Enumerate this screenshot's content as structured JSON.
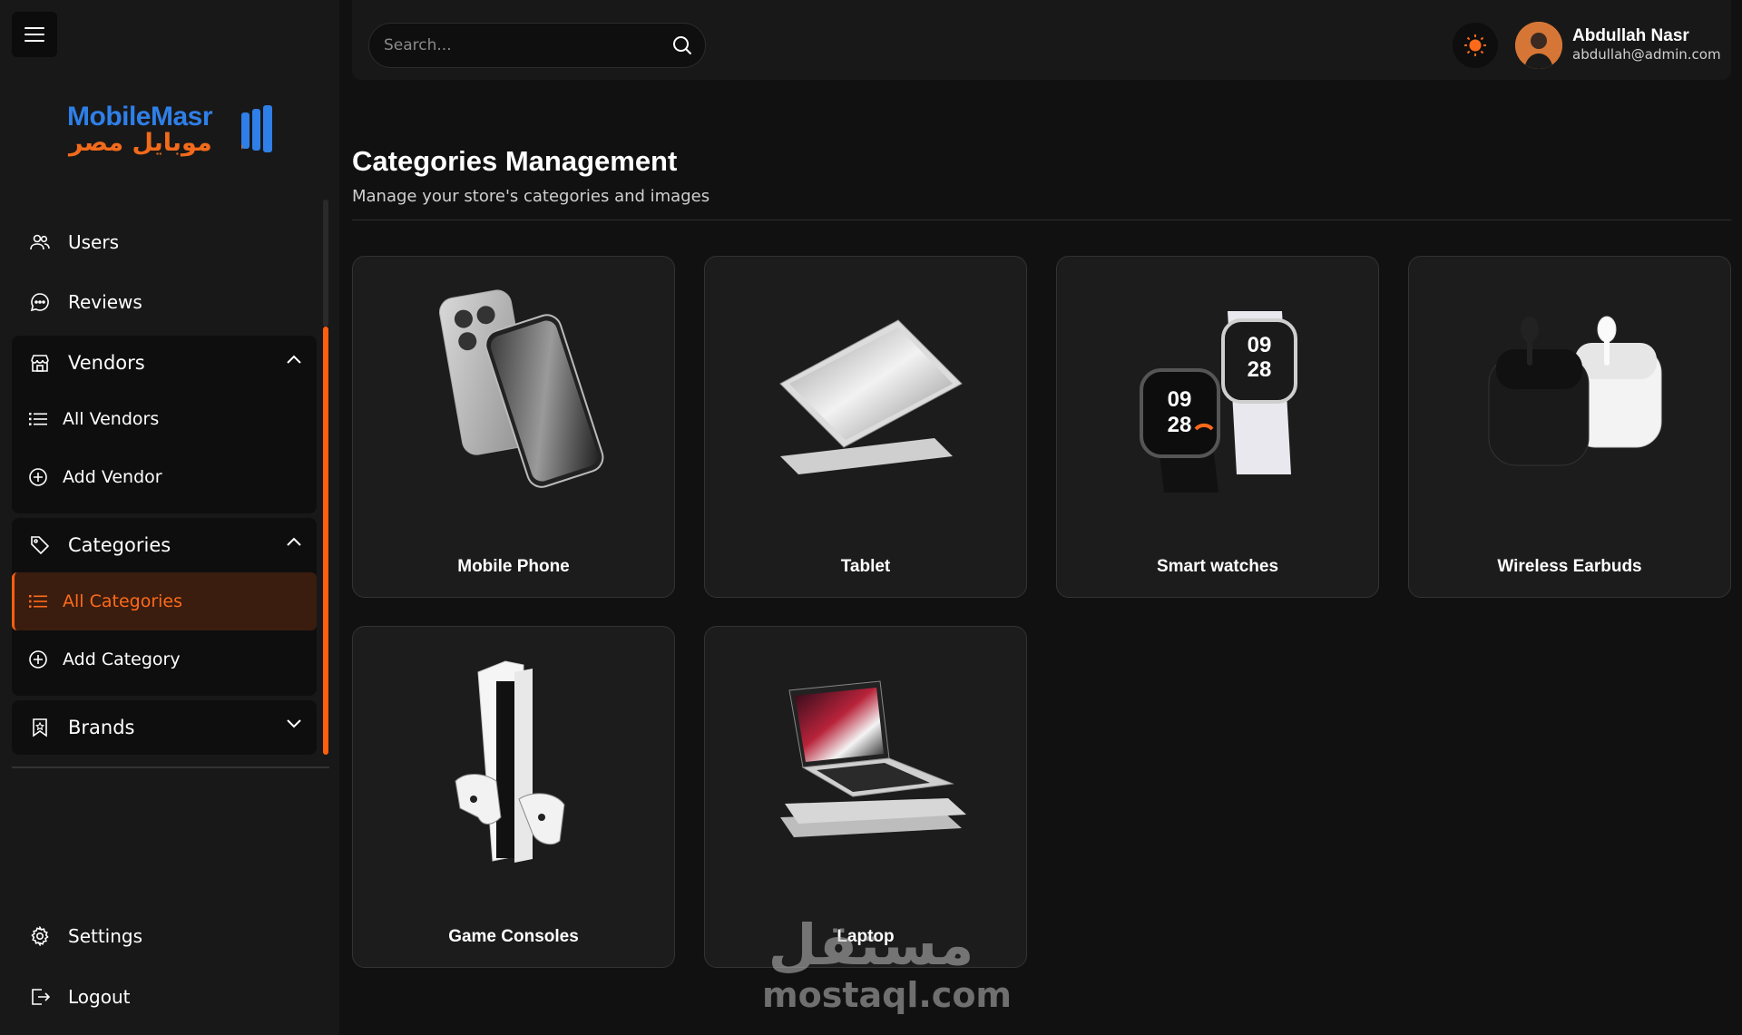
{
  "brand": {
    "name_en": "MobileMasr",
    "name_ar": "موبايل مصر",
    "color_blue": "#2f7fe8",
    "color_orange": "#f26a1b"
  },
  "accent_color": "#ff5e0e",
  "sidebar": {
    "items_top": [
      {
        "label": "Users",
        "icon": "users-icon"
      },
      {
        "label": "Reviews",
        "icon": "chat-icon"
      }
    ],
    "vendors": {
      "label": "Vendors",
      "icon": "store-icon",
      "expanded": true,
      "items": [
        {
          "label": "All Vendors",
          "icon": "list-icon"
        },
        {
          "label": "Add Vendor",
          "icon": "plus-circle-icon"
        }
      ]
    },
    "categories": {
      "label": "Categories",
      "icon": "tag-icon",
      "expanded": true,
      "items": [
        {
          "label": "All Categories",
          "icon": "list-icon",
          "active": true
        },
        {
          "label": "Add Category",
          "icon": "plus-circle-icon"
        }
      ]
    },
    "brands": {
      "label": "Brands",
      "icon": "bookmark-icon",
      "expanded": false
    },
    "items_bottom": [
      {
        "label": "Settings",
        "icon": "gear-icon"
      },
      {
        "label": "Logout",
        "icon": "logout-icon"
      }
    ]
  },
  "header": {
    "search_placeholder": "Search...",
    "user": {
      "name": "Abdullah Nasr",
      "email": "abdullah@admin.com"
    }
  },
  "main": {
    "title": "Categories Management",
    "subtitle": "Manage your store's categories and images",
    "categories": [
      {
        "label": "Mobile Phone",
        "image": "mobile-phone-image"
      },
      {
        "label": "Tablet",
        "image": "tablet-image"
      },
      {
        "label": "Smart watches",
        "image": "smartwatch-image"
      },
      {
        "label": "Wireless Earbuds",
        "image": "earbuds-image"
      },
      {
        "label": "Game Consoles",
        "image": "console-image"
      },
      {
        "label": "Laptop",
        "image": "laptop-image"
      }
    ]
  },
  "watermark": {
    "ar": "مستقل",
    "en": "mostaql.com"
  }
}
